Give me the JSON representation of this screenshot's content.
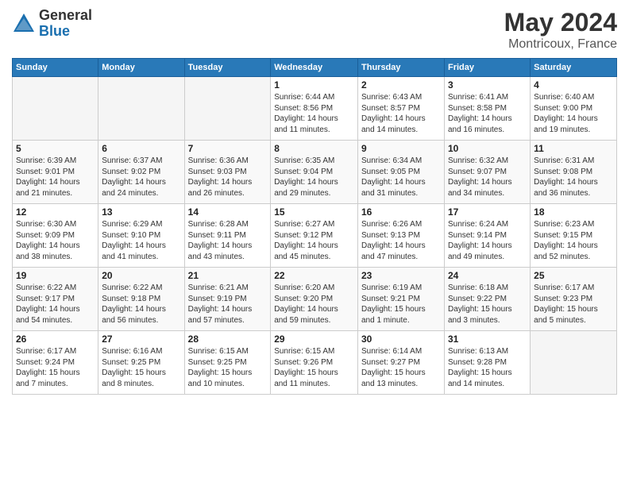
{
  "logo": {
    "general": "General",
    "blue": "Blue"
  },
  "title": "May 2024",
  "subtitle": "Montricoux, France",
  "days_of_week": [
    "Sunday",
    "Monday",
    "Tuesday",
    "Wednesday",
    "Thursday",
    "Friday",
    "Saturday"
  ],
  "weeks": [
    [
      {
        "num": "",
        "info": ""
      },
      {
        "num": "",
        "info": ""
      },
      {
        "num": "",
        "info": ""
      },
      {
        "num": "1",
        "info": "Sunrise: 6:44 AM\nSunset: 8:56 PM\nDaylight: 14 hours\nand 11 minutes."
      },
      {
        "num": "2",
        "info": "Sunrise: 6:43 AM\nSunset: 8:57 PM\nDaylight: 14 hours\nand 14 minutes."
      },
      {
        "num": "3",
        "info": "Sunrise: 6:41 AM\nSunset: 8:58 PM\nDaylight: 14 hours\nand 16 minutes."
      },
      {
        "num": "4",
        "info": "Sunrise: 6:40 AM\nSunset: 9:00 PM\nDaylight: 14 hours\nand 19 minutes."
      }
    ],
    [
      {
        "num": "5",
        "info": "Sunrise: 6:39 AM\nSunset: 9:01 PM\nDaylight: 14 hours\nand 21 minutes."
      },
      {
        "num": "6",
        "info": "Sunrise: 6:37 AM\nSunset: 9:02 PM\nDaylight: 14 hours\nand 24 minutes."
      },
      {
        "num": "7",
        "info": "Sunrise: 6:36 AM\nSunset: 9:03 PM\nDaylight: 14 hours\nand 26 minutes."
      },
      {
        "num": "8",
        "info": "Sunrise: 6:35 AM\nSunset: 9:04 PM\nDaylight: 14 hours\nand 29 minutes."
      },
      {
        "num": "9",
        "info": "Sunrise: 6:34 AM\nSunset: 9:05 PM\nDaylight: 14 hours\nand 31 minutes."
      },
      {
        "num": "10",
        "info": "Sunrise: 6:32 AM\nSunset: 9:07 PM\nDaylight: 14 hours\nand 34 minutes."
      },
      {
        "num": "11",
        "info": "Sunrise: 6:31 AM\nSunset: 9:08 PM\nDaylight: 14 hours\nand 36 minutes."
      }
    ],
    [
      {
        "num": "12",
        "info": "Sunrise: 6:30 AM\nSunset: 9:09 PM\nDaylight: 14 hours\nand 38 minutes."
      },
      {
        "num": "13",
        "info": "Sunrise: 6:29 AM\nSunset: 9:10 PM\nDaylight: 14 hours\nand 41 minutes."
      },
      {
        "num": "14",
        "info": "Sunrise: 6:28 AM\nSunset: 9:11 PM\nDaylight: 14 hours\nand 43 minutes."
      },
      {
        "num": "15",
        "info": "Sunrise: 6:27 AM\nSunset: 9:12 PM\nDaylight: 14 hours\nand 45 minutes."
      },
      {
        "num": "16",
        "info": "Sunrise: 6:26 AM\nSunset: 9:13 PM\nDaylight: 14 hours\nand 47 minutes."
      },
      {
        "num": "17",
        "info": "Sunrise: 6:24 AM\nSunset: 9:14 PM\nDaylight: 14 hours\nand 49 minutes."
      },
      {
        "num": "18",
        "info": "Sunrise: 6:23 AM\nSunset: 9:15 PM\nDaylight: 14 hours\nand 52 minutes."
      }
    ],
    [
      {
        "num": "19",
        "info": "Sunrise: 6:22 AM\nSunset: 9:17 PM\nDaylight: 14 hours\nand 54 minutes."
      },
      {
        "num": "20",
        "info": "Sunrise: 6:22 AM\nSunset: 9:18 PM\nDaylight: 14 hours\nand 56 minutes."
      },
      {
        "num": "21",
        "info": "Sunrise: 6:21 AM\nSunset: 9:19 PM\nDaylight: 14 hours\nand 57 minutes."
      },
      {
        "num": "22",
        "info": "Sunrise: 6:20 AM\nSunset: 9:20 PM\nDaylight: 14 hours\nand 59 minutes."
      },
      {
        "num": "23",
        "info": "Sunrise: 6:19 AM\nSunset: 9:21 PM\nDaylight: 15 hours\nand 1 minute."
      },
      {
        "num": "24",
        "info": "Sunrise: 6:18 AM\nSunset: 9:22 PM\nDaylight: 15 hours\nand 3 minutes."
      },
      {
        "num": "25",
        "info": "Sunrise: 6:17 AM\nSunset: 9:23 PM\nDaylight: 15 hours\nand 5 minutes."
      }
    ],
    [
      {
        "num": "26",
        "info": "Sunrise: 6:17 AM\nSunset: 9:24 PM\nDaylight: 15 hours\nand 7 minutes."
      },
      {
        "num": "27",
        "info": "Sunrise: 6:16 AM\nSunset: 9:25 PM\nDaylight: 15 hours\nand 8 minutes."
      },
      {
        "num": "28",
        "info": "Sunrise: 6:15 AM\nSunset: 9:25 PM\nDaylight: 15 hours\nand 10 minutes."
      },
      {
        "num": "29",
        "info": "Sunrise: 6:15 AM\nSunset: 9:26 PM\nDaylight: 15 hours\nand 11 minutes."
      },
      {
        "num": "30",
        "info": "Sunrise: 6:14 AM\nSunset: 9:27 PM\nDaylight: 15 hours\nand 13 minutes."
      },
      {
        "num": "31",
        "info": "Sunrise: 6:13 AM\nSunset: 9:28 PM\nDaylight: 15 hours\nand 14 minutes."
      },
      {
        "num": "",
        "info": ""
      }
    ]
  ]
}
